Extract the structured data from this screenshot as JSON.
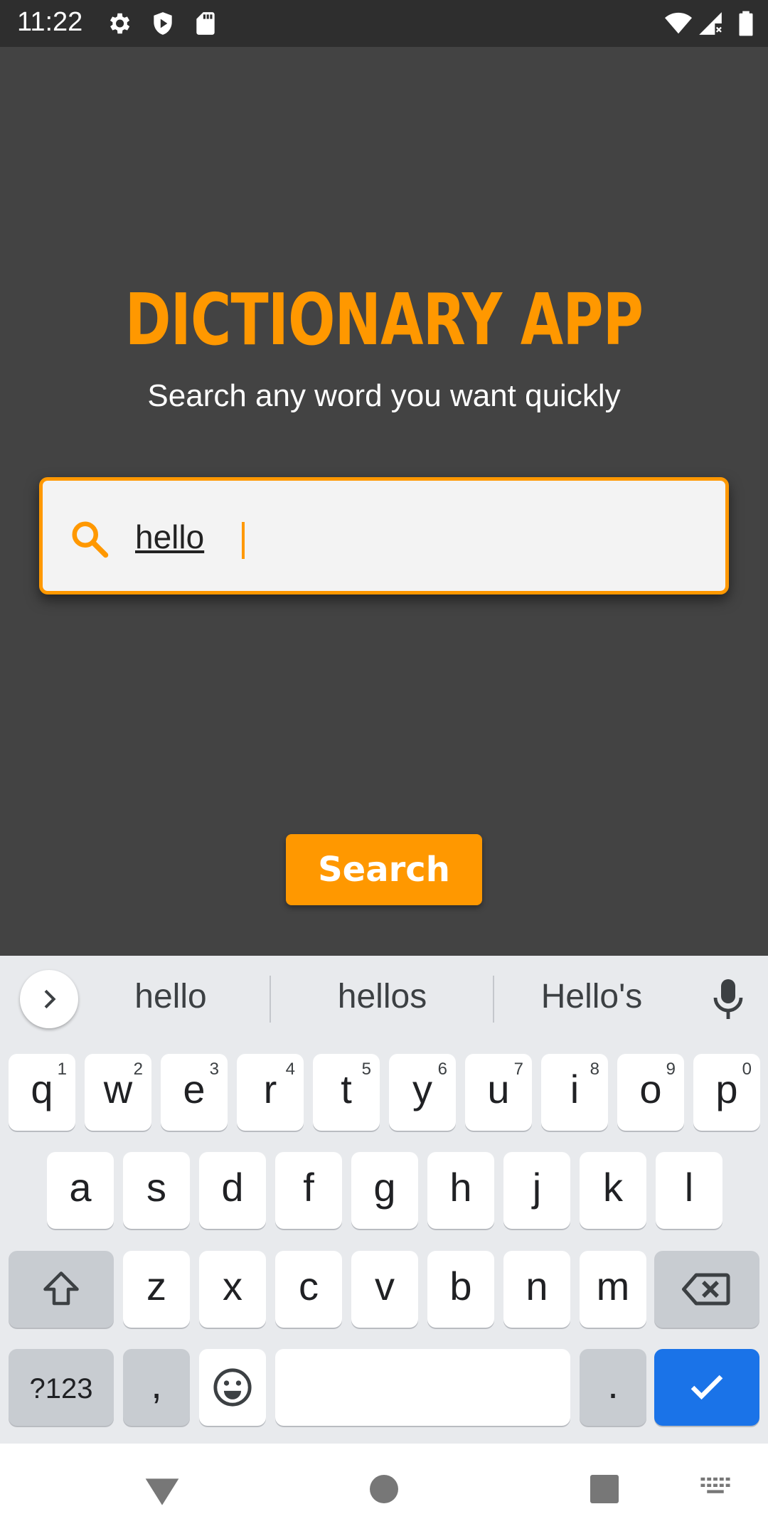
{
  "status_bar": {
    "time": "11:22",
    "icons": [
      "gear-icon",
      "shield-icon",
      "sd-card-icon",
      "wifi-icon",
      "cellular-icon",
      "battery-icon"
    ]
  },
  "app": {
    "title": "DICTIONARY APP",
    "subtitle": "Search any word you want quickly",
    "search": {
      "value": "hello",
      "icon": "search-icon"
    },
    "search_button": "Search"
  },
  "keyboard": {
    "suggestions": [
      "hello",
      "hellos",
      "Hello's"
    ],
    "row1": [
      {
        "key": "q",
        "hint": "1"
      },
      {
        "key": "w",
        "hint": "2"
      },
      {
        "key": "e",
        "hint": "3"
      },
      {
        "key": "r",
        "hint": "4"
      },
      {
        "key": "t",
        "hint": "5"
      },
      {
        "key": "y",
        "hint": "6"
      },
      {
        "key": "u",
        "hint": "7"
      },
      {
        "key": "i",
        "hint": "8"
      },
      {
        "key": "o",
        "hint": "9"
      },
      {
        "key": "p",
        "hint": "0"
      }
    ],
    "row2": [
      "a",
      "s",
      "d",
      "f",
      "g",
      "h",
      "j",
      "k",
      "l"
    ],
    "row3": [
      "z",
      "x",
      "c",
      "v",
      "b",
      "n",
      "m"
    ],
    "row4": {
      "symbols": "?123",
      "comma": ",",
      "period": "."
    }
  },
  "colors": {
    "accent": "#ff9800",
    "background": "#434343",
    "enter_key": "#1a73e8"
  }
}
